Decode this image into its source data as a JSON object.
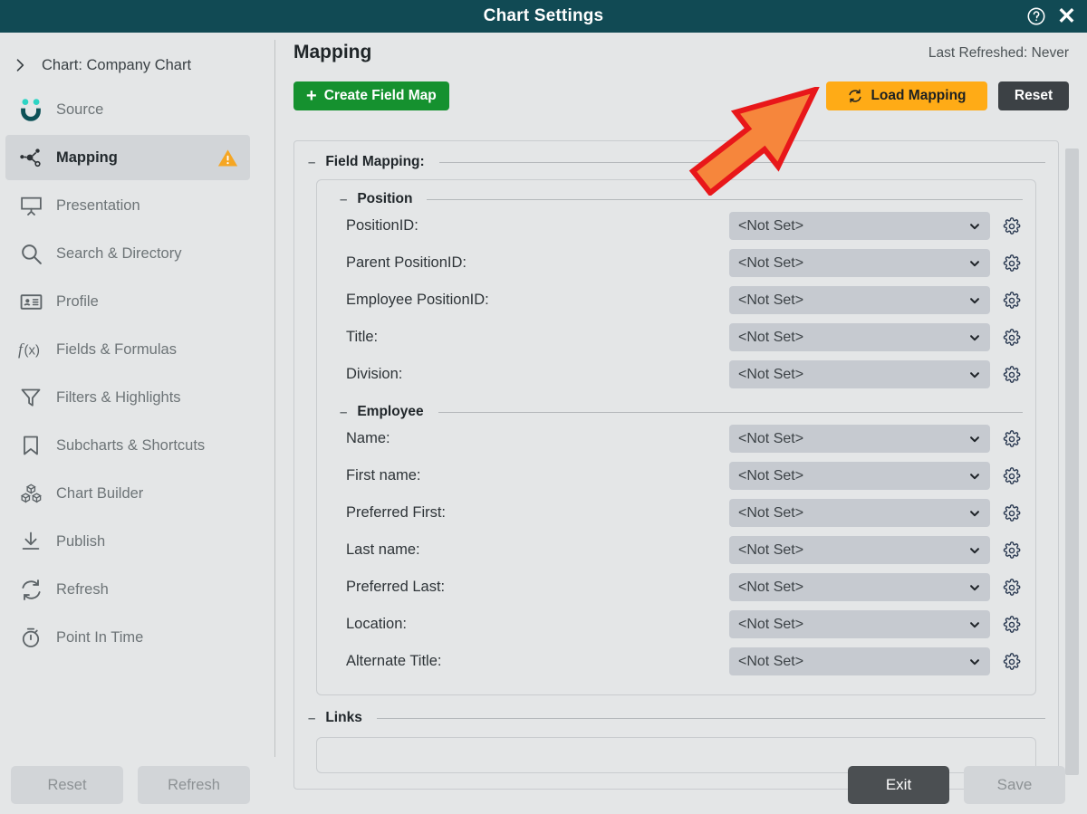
{
  "window": {
    "title": "Chart Settings",
    "help_icon": "question-circle-icon",
    "close_icon": "close-icon"
  },
  "sidebar": {
    "breadcrumb": {
      "chevron_icon": "chevron-right-icon",
      "label": "Chart:  Company Chart"
    },
    "items": [
      {
        "label": "Source",
        "icon": "source-smiley-icon",
        "active": false,
        "warning": false
      },
      {
        "label": "Mapping",
        "icon": "mapping-nodes-icon",
        "active": true,
        "warning": true
      },
      {
        "label": "Presentation",
        "icon": "presentation-screen-icon",
        "active": false,
        "warning": false
      },
      {
        "label": "Search & Directory",
        "icon": "search-icon",
        "active": false,
        "warning": false
      },
      {
        "label": "Profile",
        "icon": "id-card-icon",
        "active": false,
        "warning": false
      },
      {
        "label": "Fields & Formulas",
        "icon": "function-fx-icon",
        "active": false,
        "warning": false
      },
      {
        "label": "Filters & Highlights",
        "icon": "funnel-filter-icon",
        "active": false,
        "warning": false
      },
      {
        "label": "Subcharts & Shortcuts",
        "icon": "bookmark-icon",
        "active": false,
        "warning": false
      },
      {
        "label": "Chart Builder",
        "icon": "blocks-cubes-icon",
        "active": false,
        "warning": false
      },
      {
        "label": "Publish",
        "icon": "download-arrow-icon",
        "active": false,
        "warning": false
      },
      {
        "label": "Refresh",
        "icon": "refresh-cycle-icon",
        "active": false,
        "warning": false
      },
      {
        "label": "Point In Time",
        "icon": "stopwatch-icon",
        "active": false,
        "warning": false
      }
    ],
    "footer": {
      "reset_label": "Reset",
      "refresh_label": "Refresh"
    }
  },
  "main": {
    "page_title": "Mapping",
    "last_refreshed": "Last Refreshed: Never",
    "toolbar": {
      "create_field_map_label": "Create Field Map",
      "create_field_map_icon": "plus-icon",
      "load_mapping_label": "Load Mapping",
      "load_mapping_icon": "refresh-cycle-icon",
      "reset_label": "Reset"
    },
    "field_mapping_legend": "Field Mapping:",
    "collapse_glyph": "–",
    "groups": [
      {
        "legend": "Position",
        "fields": [
          {
            "label": "PositionID:",
            "value": "<Not Set>",
            "gear_icon": "gear-icon"
          },
          {
            "label": "Parent PositionID:",
            "value": "<Not Set>",
            "gear_icon": "gear-icon"
          },
          {
            "label": "Employee PositionID:",
            "value": "<Not Set>",
            "gear_icon": "gear-icon"
          },
          {
            "label": "Title:",
            "value": "<Not Set>",
            "gear_icon": "gear-icon"
          },
          {
            "label": "Division:",
            "value": "<Not Set>",
            "gear_icon": "gear-icon"
          }
        ]
      },
      {
        "legend": "Employee",
        "fields": [
          {
            "label": "Name:",
            "value": "<Not Set>",
            "gear_icon": "gear-icon"
          },
          {
            "label": "First name:",
            "value": "<Not Set>",
            "gear_icon": "gear-icon"
          },
          {
            "label": "Preferred First:",
            "value": "<Not Set>",
            "gear_icon": "gear-icon"
          },
          {
            "label": "Last name:",
            "value": "<Not Set>",
            "gear_icon": "gear-icon"
          },
          {
            "label": "Preferred Last:",
            "value": "<Not Set>",
            "gear_icon": "gear-icon"
          },
          {
            "label": "Location:",
            "value": "<Not Set>",
            "gear_icon": "gear-icon"
          },
          {
            "label": "Alternate Title:",
            "value": "<Not Set>",
            "gear_icon": "gear-icon"
          }
        ]
      }
    ],
    "links_legend": "Links",
    "footer": {
      "exit_label": "Exit",
      "save_label": "Save"
    }
  },
  "annotation": {
    "arrow_icon": "pointer-arrow-icon",
    "fill": "#F6863C",
    "stroke": "#E8171A"
  },
  "colors": {
    "titlebar": "#114a54",
    "page_bg": "#e4e6e7",
    "accent_green": "#15912f",
    "accent_amber": "#ffab16",
    "dark_button": "#3c4145",
    "warning": "#f5a623",
    "source_teal": "#0c5157",
    "source_dot": "#2dd4c4"
  }
}
